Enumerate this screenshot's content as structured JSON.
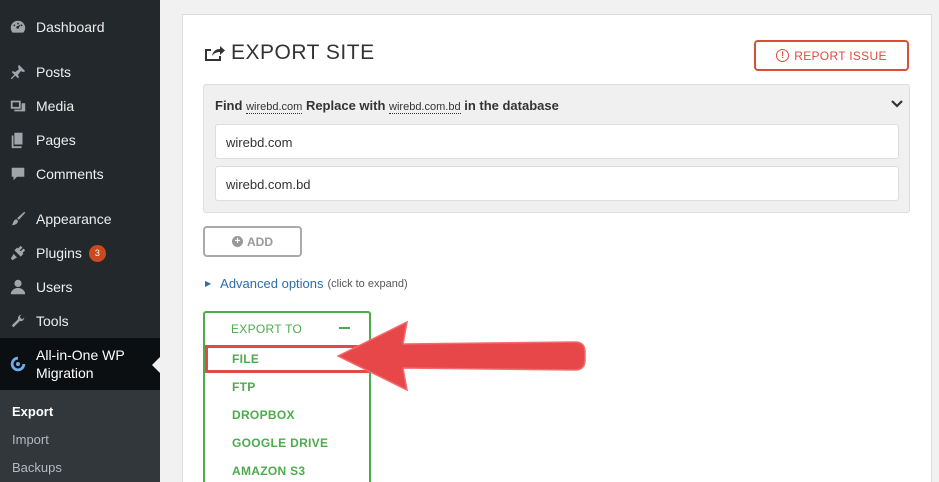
{
  "sidebar": {
    "items": [
      {
        "label": "Dashboard",
        "icon": "dashboard-icon"
      },
      {
        "label": "Posts",
        "icon": "pin-icon"
      },
      {
        "label": "Media",
        "icon": "media-icon"
      },
      {
        "label": "Pages",
        "icon": "pages-icon"
      },
      {
        "label": "Comments",
        "icon": "comment-icon"
      },
      {
        "label": "Appearance",
        "icon": "brush-icon"
      },
      {
        "label": "Plugins",
        "icon": "plug-icon",
        "badge": "3"
      },
      {
        "label": "Users",
        "icon": "user-icon"
      },
      {
        "label": "Tools",
        "icon": "wrench-icon"
      }
    ],
    "active": {
      "line1": "All-in-One WP",
      "line2": "Migration",
      "icon": "migration-icon"
    },
    "submenu": [
      "Export",
      "Import",
      "Backups"
    ]
  },
  "main": {
    "title": "EXPORT SITE",
    "report_issue": "REPORT ISSUE",
    "find": {
      "find_label": "Find",
      "find_value": "wirebd.com",
      "replace_label": "Replace with",
      "replace_value": "wirebd.com.bd",
      "suffix": "in the database"
    },
    "fields": [
      "wirebd.com",
      "wirebd.com.bd"
    ],
    "add_label": "ADD",
    "advanced": {
      "label": "Advanced options",
      "hint": "(click to expand)"
    },
    "export_to": {
      "label": "EXPORT TO",
      "options": [
        "FILE",
        "FTP",
        "DROPBOX",
        "GOOGLE DRIVE",
        "AMAZON S3"
      ]
    }
  },
  "colors": {
    "green": "#4dab4d",
    "red": "#dd4b39",
    "link": "#2a6ead",
    "sidebar": "#23282d"
  }
}
